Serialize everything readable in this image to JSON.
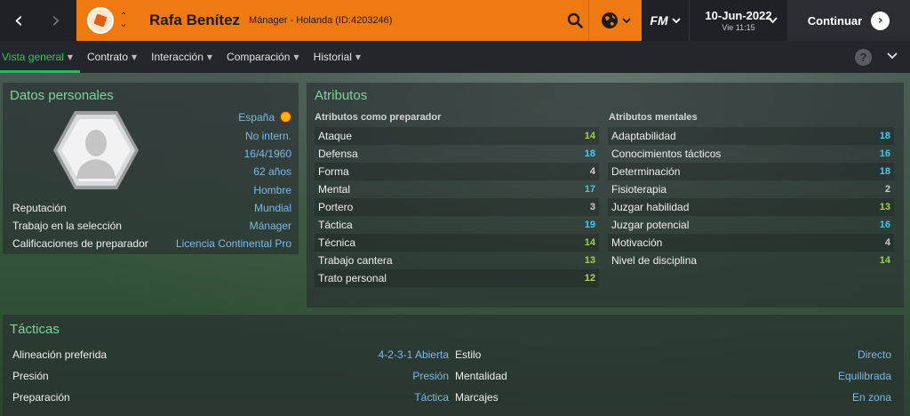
{
  "header": {
    "person_name": "Rafa Benítez",
    "person_role": "Mánager - Holanda (ID:4203246)",
    "logo": "FM",
    "date": "10-Jun-2022",
    "time": "Vie 11:15",
    "continue_label": "Continuar",
    "accent_color": "#f07a12"
  },
  "tabs": [
    {
      "label": "Vista general",
      "active": true
    },
    {
      "label": "Contrato"
    },
    {
      "label": "Interacción"
    },
    {
      "label": "Comparación"
    },
    {
      "label": "Historial"
    }
  ],
  "help_label": "?",
  "personal": {
    "title": "Datos personales",
    "nationality": "España",
    "international": "No intern.",
    "birth_date": "16/4/1960",
    "age": "62 años",
    "gender": "Hombre",
    "rows": [
      {
        "label": "Reputación",
        "value": "Mundial"
      },
      {
        "label": "Trabajo en la selección",
        "value": "Mánager"
      },
      {
        "label": "Calificaciones de preparador",
        "value": "Licencia Continental Pro"
      }
    ]
  },
  "attributes": {
    "title": "Atributos",
    "coaching": {
      "title": "Atributos como preparador",
      "items": [
        {
          "label": "Ataque",
          "value": "14"
        },
        {
          "label": "Defensa",
          "value": "18"
        },
        {
          "label": "Forma",
          "value": "4"
        },
        {
          "label": "Mental",
          "value": "17"
        },
        {
          "label": "Portero",
          "value": "3"
        },
        {
          "label": "Táctica",
          "value": "19"
        },
        {
          "label": "Técnica",
          "value": "14"
        },
        {
          "label": "Trabajo cantera",
          "value": "13"
        },
        {
          "label": "Trato personal",
          "value": "12"
        }
      ]
    },
    "mental": {
      "title": "Atributos mentales",
      "items": [
        {
          "label": "Adaptabilidad",
          "value": "18"
        },
        {
          "label": "Conocimientos tácticos",
          "value": "16"
        },
        {
          "label": "Determinación",
          "value": "18"
        },
        {
          "label": "Fisioterapia",
          "value": "2"
        },
        {
          "label": "Juzgar habilidad",
          "value": "13"
        },
        {
          "label": "Juzgar potencial",
          "value": "16"
        },
        {
          "label": "Motivación",
          "value": "4"
        },
        {
          "label": "Nivel de disciplina",
          "value": "14"
        }
      ]
    }
  },
  "tactics": {
    "title": "Tácticas",
    "left": [
      {
        "label": "Alineación preferida",
        "value": "4-2-3-1 Abierta"
      },
      {
        "label": "Presión",
        "value": "Presión"
      },
      {
        "label": "Preparación",
        "value": "Táctica"
      }
    ],
    "right": [
      {
        "label": "Estilo",
        "value": "Directo"
      },
      {
        "label": "Mentalidad",
        "value": "Equilibrada"
      },
      {
        "label": "Marcajes",
        "value": "En zona"
      }
    ]
  }
}
